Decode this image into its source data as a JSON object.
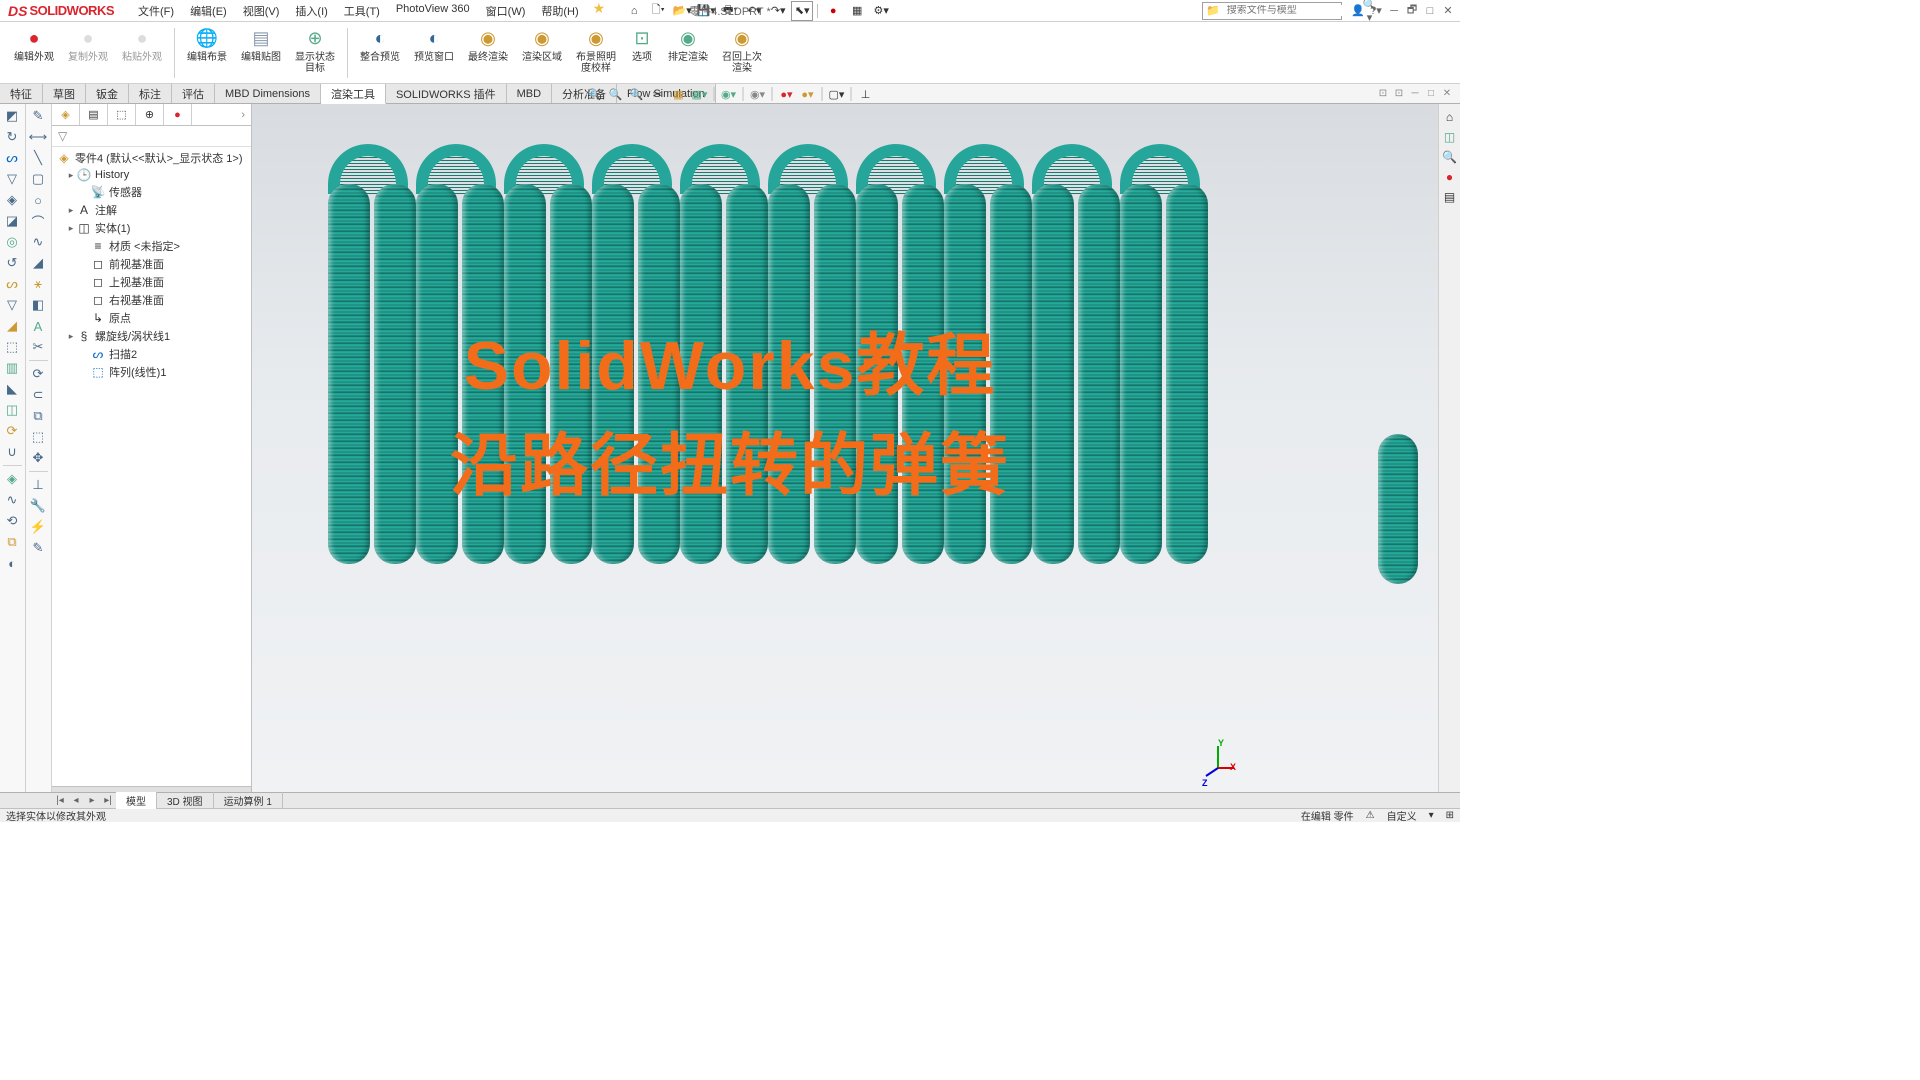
{
  "app": {
    "logo_ds": "DS",
    "logo_text": "SOLIDWORKS"
  },
  "menu": [
    "文件(F)",
    "编辑(E)",
    "视图(V)",
    "插入(I)",
    "工具(T)",
    "PhotoView 360",
    "窗口(W)",
    "帮助(H)"
  ],
  "doc_title": "零件4.SLDPRT *",
  "search_placeholder": "搜索文件与模型",
  "ribbon": [
    {
      "label": "编辑外观",
      "color": "#d9262e"
    },
    {
      "label": "复制外观",
      "color": "#bbb"
    },
    {
      "label": "粘贴外观",
      "color": "#bbb"
    },
    {
      "label": "编辑布景",
      "color": "#8a6"
    },
    {
      "label": "编辑贴图",
      "color": "#89a"
    },
    {
      "label": "显示状态目标",
      "color": "#5a8"
    },
    {
      "label": "整合预览",
      "color": "#369"
    },
    {
      "label": "预览窗口",
      "color": "#369"
    },
    {
      "label": "最终渲染",
      "color": "#c93"
    },
    {
      "label": "渲染区域",
      "color": "#c93"
    },
    {
      "label": "布景照明度校样",
      "color": "#c93"
    },
    {
      "label": "选项",
      "color": "#5a8"
    },
    {
      "label": "排定渲染",
      "color": "#5a8"
    },
    {
      "label": "召回上次渲染",
      "color": "#c93"
    }
  ],
  "tabs": [
    "特征",
    "草图",
    "钣金",
    "标注",
    "评估",
    "MBD Dimensions",
    "渲染工具",
    "SOLIDWORKS 插件",
    "MBD",
    "分析准备",
    "Flow Simulation"
  ],
  "active_tab": 6,
  "tree": {
    "root": "零件4 (默认<<默认>_显示状态 1>)",
    "items": [
      {
        "icon": "🕒",
        "label": "History",
        "expand": "▸"
      },
      {
        "icon": "📡",
        "label": "传感器"
      },
      {
        "icon": "A",
        "label": "注解",
        "expand": "▸"
      },
      {
        "icon": "◫",
        "label": "实体(1)",
        "expand": "▸"
      },
      {
        "icon": "≡",
        "label": "材质 <未指定>"
      },
      {
        "icon": "◻",
        "label": "前视基准面"
      },
      {
        "icon": "◻",
        "label": "上视基准面"
      },
      {
        "icon": "◻",
        "label": "右视基准面"
      },
      {
        "icon": "↳",
        "label": "原点"
      },
      {
        "icon": "§",
        "label": "螺旋线/涡状线1",
        "expand": "▸"
      },
      {
        "icon": "ᔕ",
        "label": "扫描2",
        "color": "#06c"
      },
      {
        "icon": "⬚",
        "label": "阵列(线性)1",
        "color": "#06c"
      }
    ]
  },
  "bottom_tabs": [
    "模型",
    "3D 视图",
    "运动算例 1"
  ],
  "active_bottom_tab": 0,
  "status_left": "选择实体以修改其外观",
  "status_right": [
    "在编辑 零件",
    "自定义"
  ],
  "overlay": {
    "line1": "SolidWorks教程",
    "line2": "沿路径扭转的弹簧"
  },
  "triad": {
    "x": "X",
    "y": "Y",
    "z": "Z"
  }
}
